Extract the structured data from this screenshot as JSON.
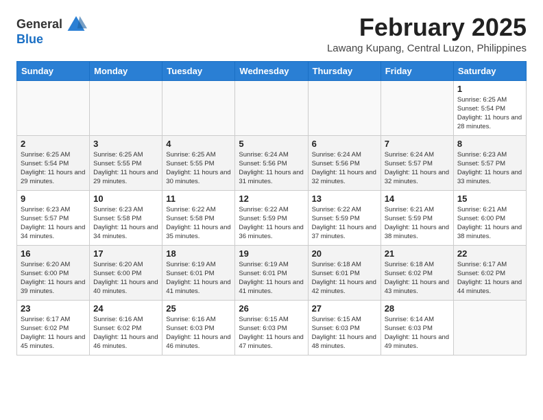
{
  "header": {
    "logo": {
      "general": "General",
      "blue": "Blue"
    },
    "month_title": "February 2025",
    "location": "Lawang Kupang, Central Luzon, Philippines"
  },
  "days_of_week": [
    "Sunday",
    "Monday",
    "Tuesday",
    "Wednesday",
    "Thursday",
    "Friday",
    "Saturday"
  ],
  "weeks": [
    [
      {
        "day": "",
        "info": ""
      },
      {
        "day": "",
        "info": ""
      },
      {
        "day": "",
        "info": ""
      },
      {
        "day": "",
        "info": ""
      },
      {
        "day": "",
        "info": ""
      },
      {
        "day": "",
        "info": ""
      },
      {
        "day": "1",
        "info": "Sunrise: 6:25 AM\nSunset: 5:54 PM\nDaylight: 11 hours and 28 minutes."
      }
    ],
    [
      {
        "day": "2",
        "info": "Sunrise: 6:25 AM\nSunset: 5:54 PM\nDaylight: 11 hours and 29 minutes."
      },
      {
        "day": "3",
        "info": "Sunrise: 6:25 AM\nSunset: 5:55 PM\nDaylight: 11 hours and 29 minutes."
      },
      {
        "day": "4",
        "info": "Sunrise: 6:25 AM\nSunset: 5:55 PM\nDaylight: 11 hours and 30 minutes."
      },
      {
        "day": "5",
        "info": "Sunrise: 6:24 AM\nSunset: 5:56 PM\nDaylight: 11 hours and 31 minutes."
      },
      {
        "day": "6",
        "info": "Sunrise: 6:24 AM\nSunset: 5:56 PM\nDaylight: 11 hours and 32 minutes."
      },
      {
        "day": "7",
        "info": "Sunrise: 6:24 AM\nSunset: 5:57 PM\nDaylight: 11 hours and 32 minutes."
      },
      {
        "day": "8",
        "info": "Sunrise: 6:23 AM\nSunset: 5:57 PM\nDaylight: 11 hours and 33 minutes."
      }
    ],
    [
      {
        "day": "9",
        "info": "Sunrise: 6:23 AM\nSunset: 5:57 PM\nDaylight: 11 hours and 34 minutes."
      },
      {
        "day": "10",
        "info": "Sunrise: 6:23 AM\nSunset: 5:58 PM\nDaylight: 11 hours and 34 minutes."
      },
      {
        "day": "11",
        "info": "Sunrise: 6:22 AM\nSunset: 5:58 PM\nDaylight: 11 hours and 35 minutes."
      },
      {
        "day": "12",
        "info": "Sunrise: 6:22 AM\nSunset: 5:59 PM\nDaylight: 11 hours and 36 minutes."
      },
      {
        "day": "13",
        "info": "Sunrise: 6:22 AM\nSunset: 5:59 PM\nDaylight: 11 hours and 37 minutes."
      },
      {
        "day": "14",
        "info": "Sunrise: 6:21 AM\nSunset: 5:59 PM\nDaylight: 11 hours and 38 minutes."
      },
      {
        "day": "15",
        "info": "Sunrise: 6:21 AM\nSunset: 6:00 PM\nDaylight: 11 hours and 38 minutes."
      }
    ],
    [
      {
        "day": "16",
        "info": "Sunrise: 6:20 AM\nSunset: 6:00 PM\nDaylight: 11 hours and 39 minutes."
      },
      {
        "day": "17",
        "info": "Sunrise: 6:20 AM\nSunset: 6:00 PM\nDaylight: 11 hours and 40 minutes."
      },
      {
        "day": "18",
        "info": "Sunrise: 6:19 AM\nSunset: 6:01 PM\nDaylight: 11 hours and 41 minutes."
      },
      {
        "day": "19",
        "info": "Sunrise: 6:19 AM\nSunset: 6:01 PM\nDaylight: 11 hours and 41 minutes."
      },
      {
        "day": "20",
        "info": "Sunrise: 6:18 AM\nSunset: 6:01 PM\nDaylight: 11 hours and 42 minutes."
      },
      {
        "day": "21",
        "info": "Sunrise: 6:18 AM\nSunset: 6:02 PM\nDaylight: 11 hours and 43 minutes."
      },
      {
        "day": "22",
        "info": "Sunrise: 6:17 AM\nSunset: 6:02 PM\nDaylight: 11 hours and 44 minutes."
      }
    ],
    [
      {
        "day": "23",
        "info": "Sunrise: 6:17 AM\nSunset: 6:02 PM\nDaylight: 11 hours and 45 minutes."
      },
      {
        "day": "24",
        "info": "Sunrise: 6:16 AM\nSunset: 6:02 PM\nDaylight: 11 hours and 46 minutes."
      },
      {
        "day": "25",
        "info": "Sunrise: 6:16 AM\nSunset: 6:03 PM\nDaylight: 11 hours and 46 minutes."
      },
      {
        "day": "26",
        "info": "Sunrise: 6:15 AM\nSunset: 6:03 PM\nDaylight: 11 hours and 47 minutes."
      },
      {
        "day": "27",
        "info": "Sunrise: 6:15 AM\nSunset: 6:03 PM\nDaylight: 11 hours and 48 minutes."
      },
      {
        "day": "28",
        "info": "Sunrise: 6:14 AM\nSunset: 6:03 PM\nDaylight: 11 hours and 49 minutes."
      },
      {
        "day": "",
        "info": ""
      }
    ]
  ]
}
